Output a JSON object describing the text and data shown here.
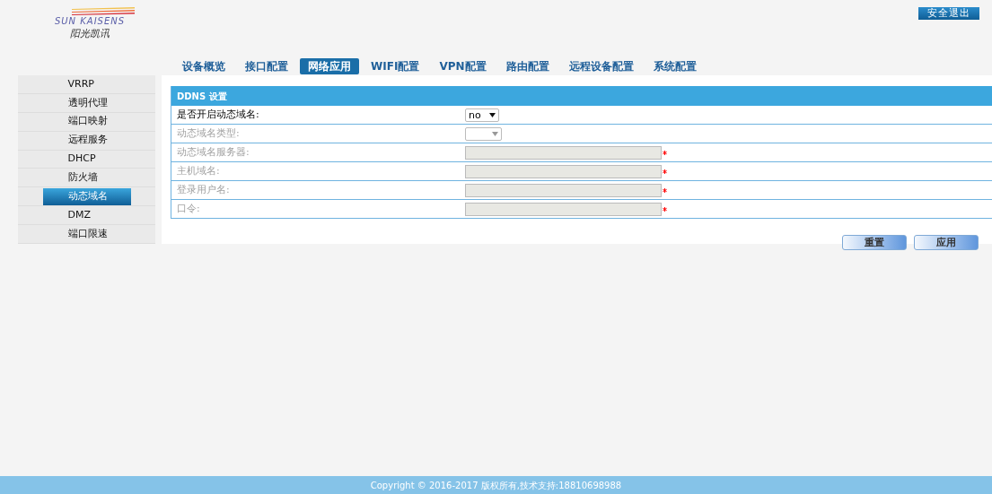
{
  "logo": {
    "brand": "SUN KAISENS",
    "subtitle": "阳光凯讯"
  },
  "logout_button": "安全退出",
  "tabs": [
    {
      "label": "设备概览",
      "selected": false
    },
    {
      "label": "接口配置",
      "selected": false
    },
    {
      "label": "网络应用",
      "selected": true
    },
    {
      "label": "WIFI配置",
      "selected": false
    },
    {
      "label": "VPN配置",
      "selected": false
    },
    {
      "label": "路由配置",
      "selected": false
    },
    {
      "label": "远程设备配置",
      "selected": false
    },
    {
      "label": "系统配置",
      "selected": false
    }
  ],
  "sidebar": {
    "items": [
      {
        "label": "VRRP",
        "selected": false
      },
      {
        "label": "透明代理",
        "selected": false
      },
      {
        "label": "端口映射",
        "selected": false
      },
      {
        "label": "远程服务",
        "selected": false
      },
      {
        "label": "DHCP",
        "selected": false
      },
      {
        "label": "防火墙",
        "selected": false
      },
      {
        "label": "动态域名",
        "selected": true
      },
      {
        "label": "DMZ",
        "selected": false
      },
      {
        "label": "端口限速",
        "selected": false
      }
    ]
  },
  "form": {
    "title": "DDNS 设置",
    "rows": [
      {
        "label": "是否开启动态域名:",
        "kind": "select",
        "value": "no",
        "disabled": false,
        "required": false
      },
      {
        "label": "动态域名类型:",
        "kind": "select",
        "disabled": true,
        "required": false
      },
      {
        "label": "动态域名服务器:",
        "kind": "input",
        "disabled": true,
        "required": true
      },
      {
        "label": "主机域名:",
        "kind": "input",
        "disabled": true,
        "required": true
      },
      {
        "label": "登录用户名:",
        "kind": "input",
        "disabled": true,
        "required": true
      },
      {
        "label": "口令:",
        "kind": "input",
        "disabled": true,
        "required": true
      }
    ]
  },
  "buttons": [
    "重置",
    "应用"
  ],
  "footer": "Copyright © 2016-2017 版权所有,技术支持:18810698988"
}
